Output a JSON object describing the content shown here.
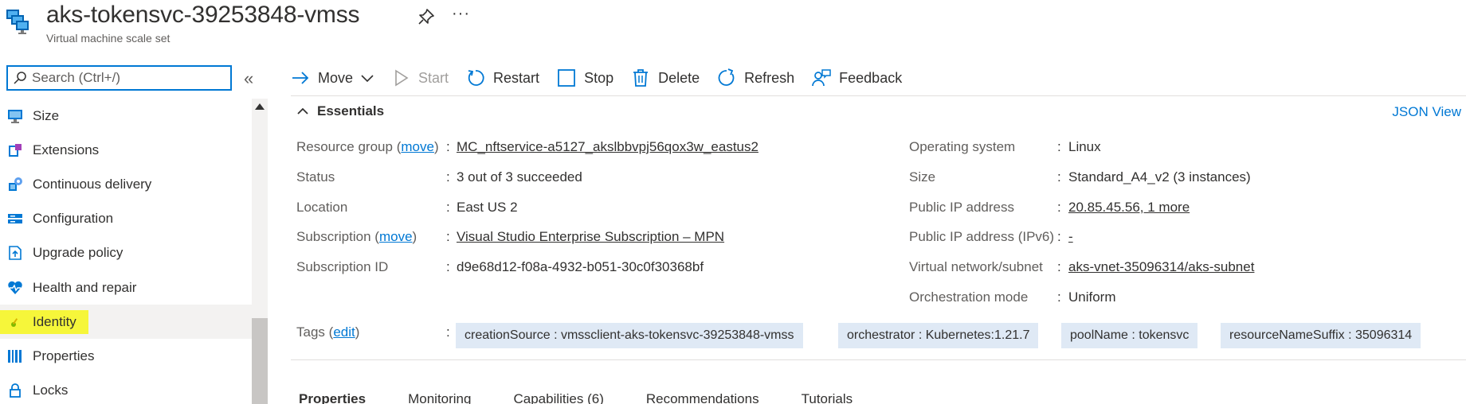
{
  "header": {
    "title": "aks-tokensvc-39253848-vmss",
    "subtitle": "Virtual machine scale set",
    "more_label": "···"
  },
  "sidebar": {
    "search_placeholder": "Search (Ctrl+/)",
    "collapse_label": "«",
    "items": [
      {
        "label": "Size",
        "icon": "monitor-icon"
      },
      {
        "label": "Extensions",
        "icon": "extensions-icon"
      },
      {
        "label": "Continuous delivery",
        "icon": "continuous-delivery-icon"
      },
      {
        "label": "Configuration",
        "icon": "configuration-icon"
      },
      {
        "label": "Upgrade policy",
        "icon": "upgrade-policy-icon"
      },
      {
        "label": "Health and repair",
        "icon": "health-icon"
      },
      {
        "label": "Identity",
        "icon": "identity-key-icon",
        "selected": true
      },
      {
        "label": "Properties",
        "icon": "properties-icon"
      },
      {
        "label": "Locks",
        "icon": "lock-icon"
      }
    ]
  },
  "toolbar": {
    "move": "Move",
    "start": "Start",
    "restart": "Restart",
    "stop": "Stop",
    "delete": "Delete",
    "refresh": "Refresh",
    "feedback": "Feedback"
  },
  "essentials": {
    "title": "Essentials",
    "json_view": "JSON View",
    "left": {
      "resource_group_label": "Resource group",
      "move_link": "move",
      "resource_group_value": "MC_nftservice-a5127_akslbbvpj56qox3w_eastus2",
      "status_label": "Status",
      "status_value": "3 out of 3 succeeded",
      "location_label": "Location",
      "location_value": "East US 2",
      "subscription_label": "Subscription",
      "subscription_value": "Visual Studio Enterprise Subscription – MPN",
      "subscription_id_label": "Subscription ID",
      "subscription_id_value": "d9e68d12-f08a-4932-b051-30c0f30368bf"
    },
    "right": {
      "os_label": "Operating system",
      "os_value": "Linux",
      "size_label": "Size",
      "size_value": "Standard_A4_v2 (3 instances)",
      "public_ip_label": "Public IP address",
      "public_ip_value": "20.85.45.56, 1 more",
      "public_ipv6_label": "Public IP address (IPv6)",
      "public_ipv6_value": "-",
      "vnet_label": "Virtual network/subnet",
      "vnet_value": "aks-vnet-35096314/aks-subnet",
      "orchestration_label": "Orchestration mode",
      "orchestration_value": "Uniform"
    },
    "tags_label": "Tags",
    "tags_edit": "edit",
    "tags": [
      "creationSource : vmssclient-aks-tokensvc-39253848-vmss",
      "orchestrator : Kubernetes:1.21.7",
      "poolName : tokensvc",
      "resourceNameSuffix : 35096314"
    ]
  },
  "tabs": [
    "Properties",
    "Monitoring",
    "Capabilities (6)",
    "Recommendations",
    "Tutorials"
  ],
  "colors": {
    "accent": "#0078d4",
    "highlight": "#ffff3d",
    "tag_bg": "#dfe9f5"
  }
}
